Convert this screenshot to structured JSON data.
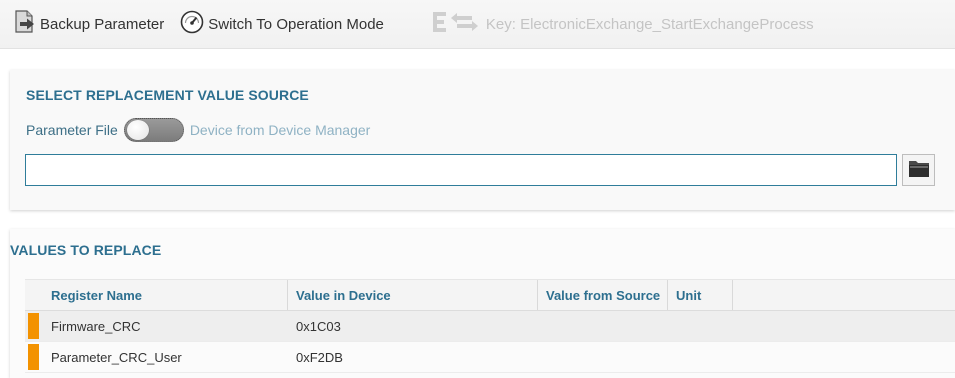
{
  "toolbar": {
    "backup_label": "Backup Parameter",
    "switch_label": "Switch To Operation Mode",
    "key_label": "Key: ElectronicExchange_StartExchangeProcess"
  },
  "source": {
    "title": "SELECT REPLACEMENT VALUE SOURCE",
    "option_left": "Parameter File",
    "option_right": "Device from Device Manager",
    "toggle_state": "Parameter File",
    "path_value": ""
  },
  "values": {
    "title": "VALUES TO REPLACE",
    "columns": [
      "Register Name",
      "Value in Device",
      "Value from Source",
      "Unit"
    ],
    "rows": [
      {
        "register": "Firmware_CRC",
        "device_value": "0x1C03",
        "source_value": "",
        "unit": ""
      },
      {
        "register": "Parameter_CRC_User",
        "device_value": "0xF2DB",
        "source_value": "",
        "unit": ""
      }
    ]
  },
  "colors": {
    "accent": "#2d6f8f",
    "row_indicator": "#f39200",
    "input_border": "#2f7d9a"
  },
  "icons": {
    "backup": "export-document-icon",
    "switch": "speedometer-icon",
    "key": "exchange-arrows-icon",
    "browse": "folder-icon"
  }
}
